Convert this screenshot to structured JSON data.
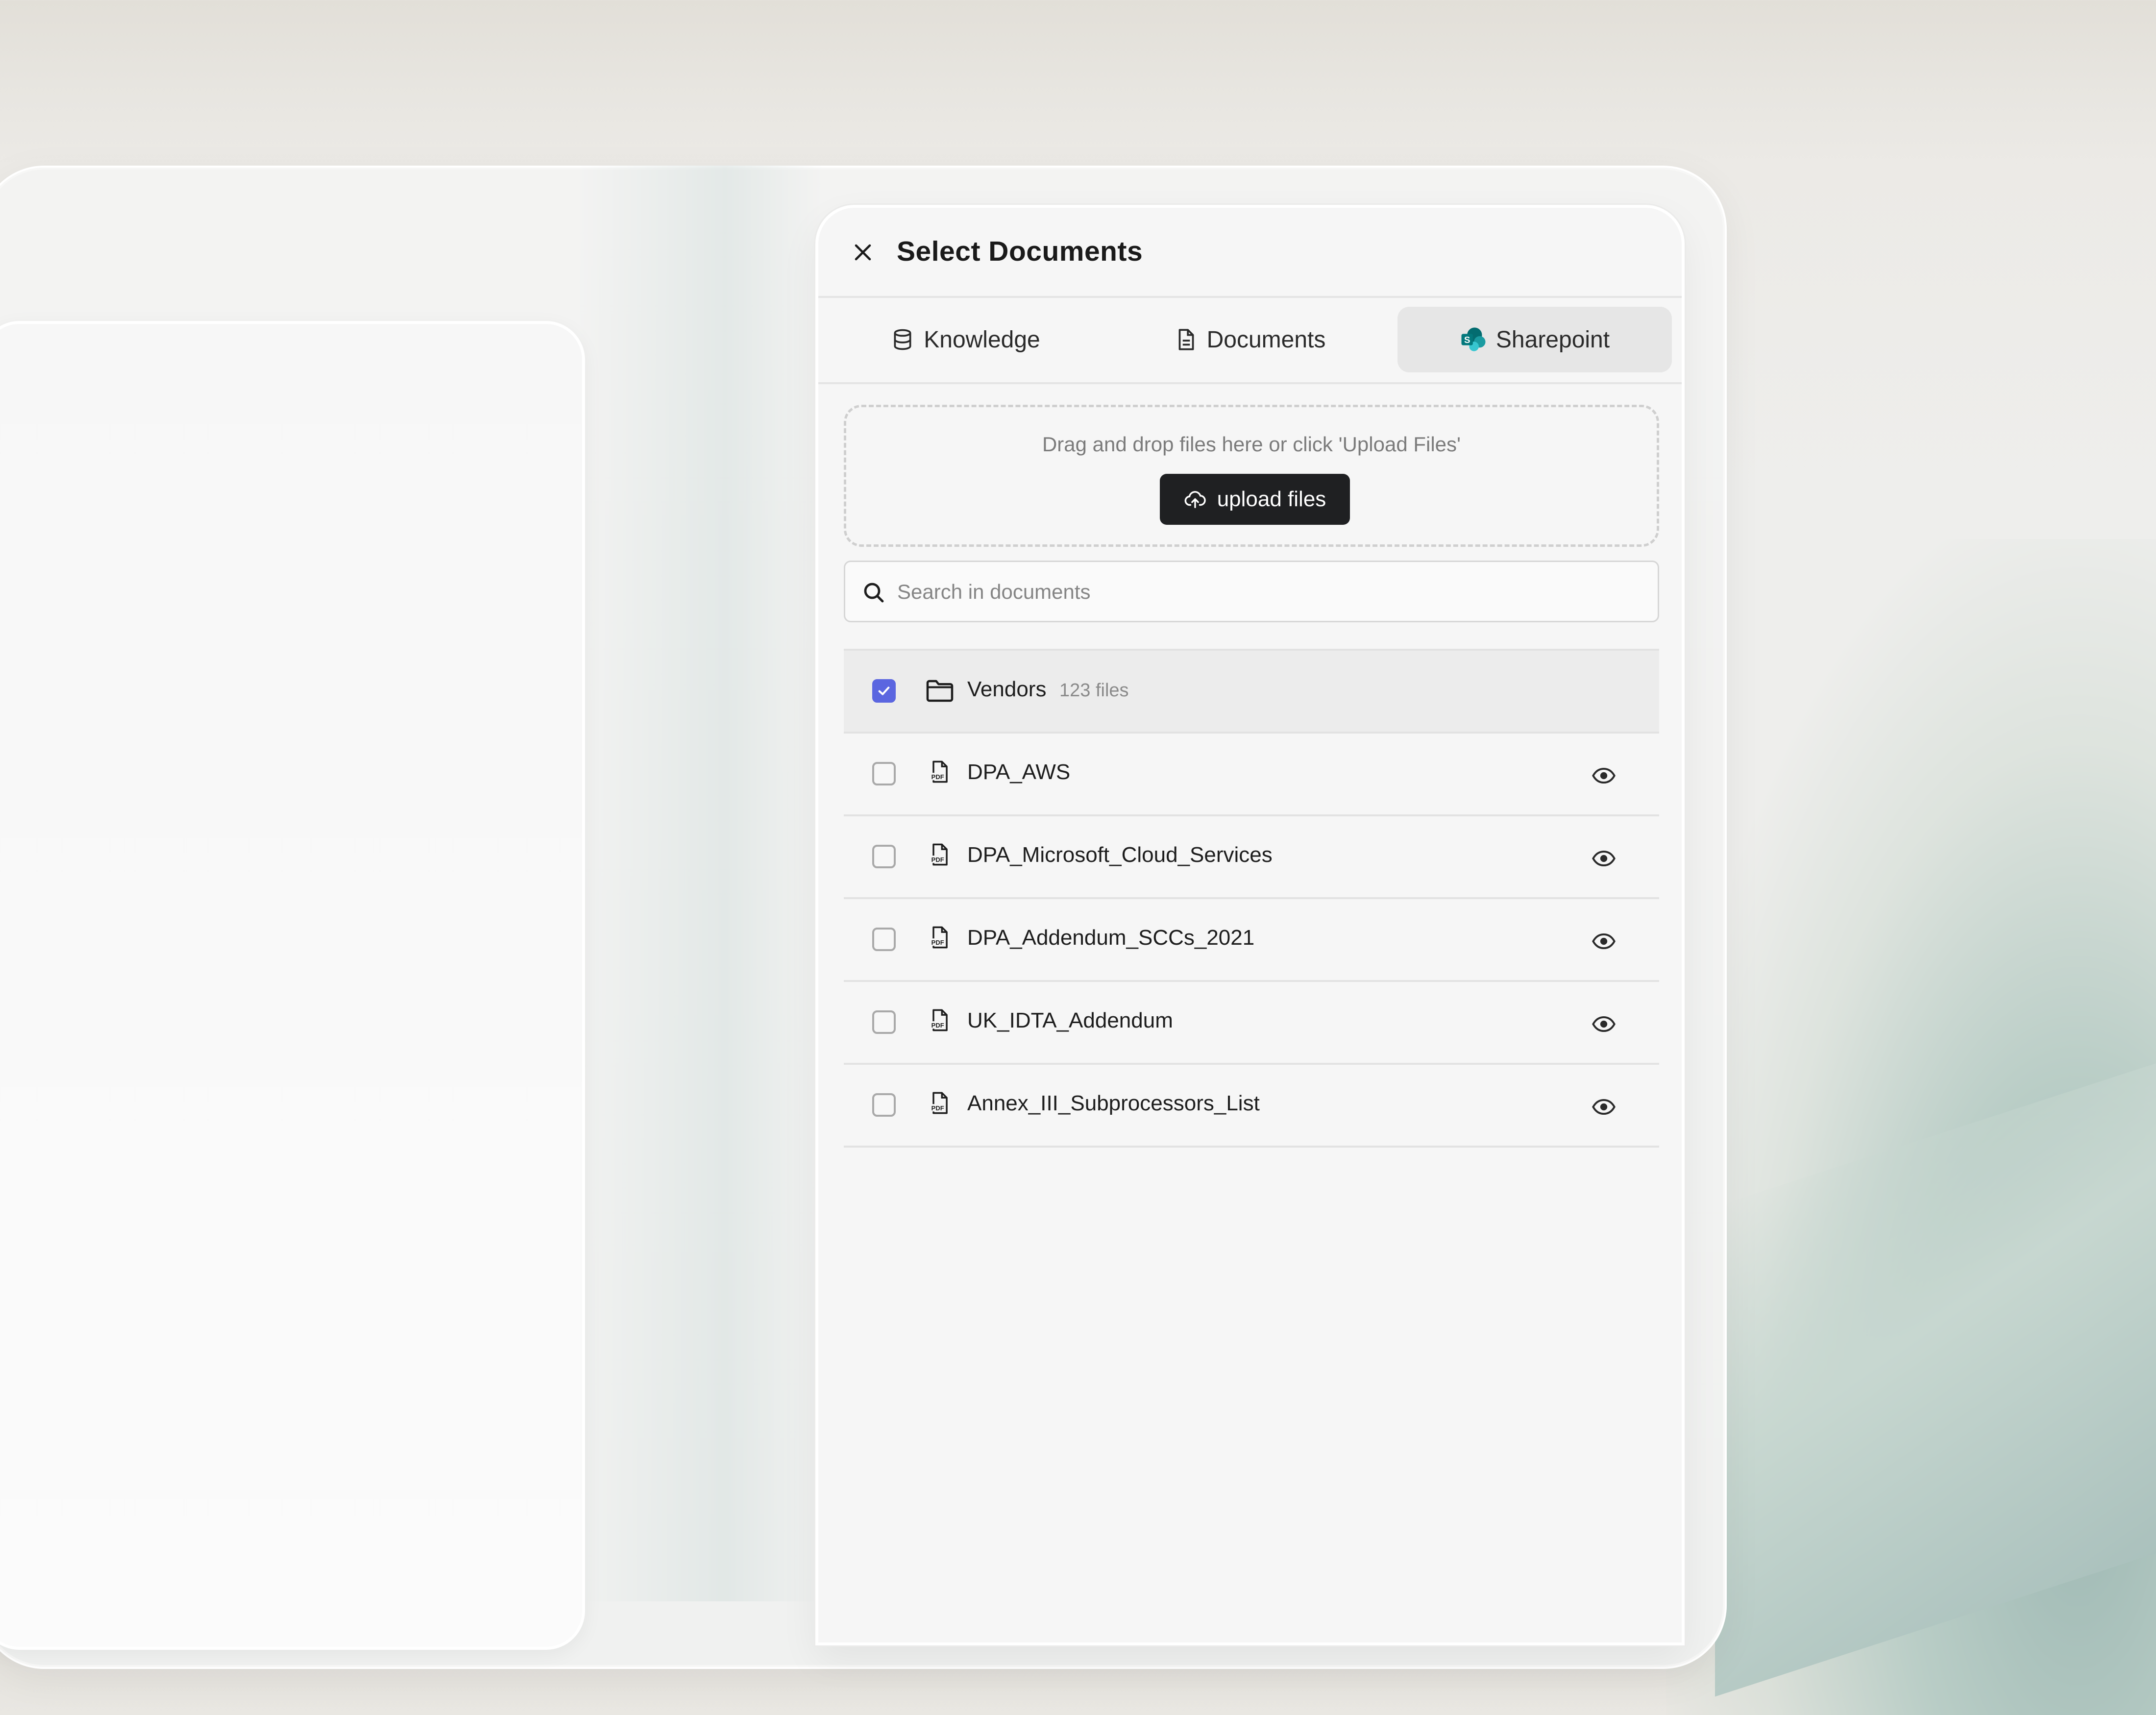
{
  "dialog": {
    "title": "Select Documents"
  },
  "tabs": [
    {
      "label": "Knowledge",
      "icon": "database-icon",
      "active": false
    },
    {
      "label": "Documents",
      "icon": "document-icon",
      "active": false
    },
    {
      "label": "Sharepoint",
      "icon": "sharepoint-icon",
      "active": true
    }
  ],
  "dropzone": {
    "text": "Drag and drop files here or click 'Upload Files'",
    "button_label": "upload files"
  },
  "search": {
    "placeholder": "Search in documents"
  },
  "folder": {
    "name": "Vendors",
    "count": "123 files",
    "checked": true
  },
  "files": [
    {
      "name": "DPA_AWS",
      "checked": false
    },
    {
      "name": "DPA_Microsoft_Cloud_Services",
      "checked": false
    },
    {
      "name": "DPA_Addendum_SCCs_2021",
      "checked": false
    },
    {
      "name": "UK_IDTA_Addendum",
      "checked": false
    },
    {
      "name": "Annex_III_Subprocessors_List",
      "checked": false
    }
  ],
  "colors": {
    "accent": "#5b66e0",
    "button_bg": "#1f2022",
    "sharepoint_teal": "#038387"
  }
}
